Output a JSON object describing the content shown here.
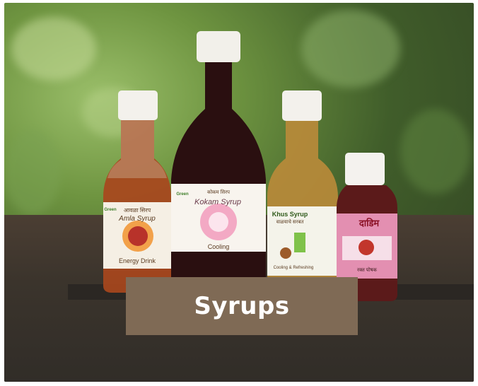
{
  "banner": {
    "title": "Syrups"
  },
  "bottles": [
    {
      "name": "Amla Syrup",
      "script_text": "आवळा सिरप",
      "tagline": "Energy Drink",
      "brand": "Green"
    },
    {
      "name": "Kokam Syrup",
      "script_text": "कोकम सिरप",
      "tagline": "Cooling",
      "brand": "Green"
    },
    {
      "name": "Khus Syrup",
      "script_text": "वाळयाचे सरबत",
      "tagline": "Cooling & Refreshing"
    },
    {
      "name": "दाडिम",
      "tagline": "रक्त पोषक"
    }
  ],
  "colors": {
    "banner_bg": "#7f6a55",
    "banner_text": "#ffffff",
    "background_foliage": "#4f6e33"
  }
}
